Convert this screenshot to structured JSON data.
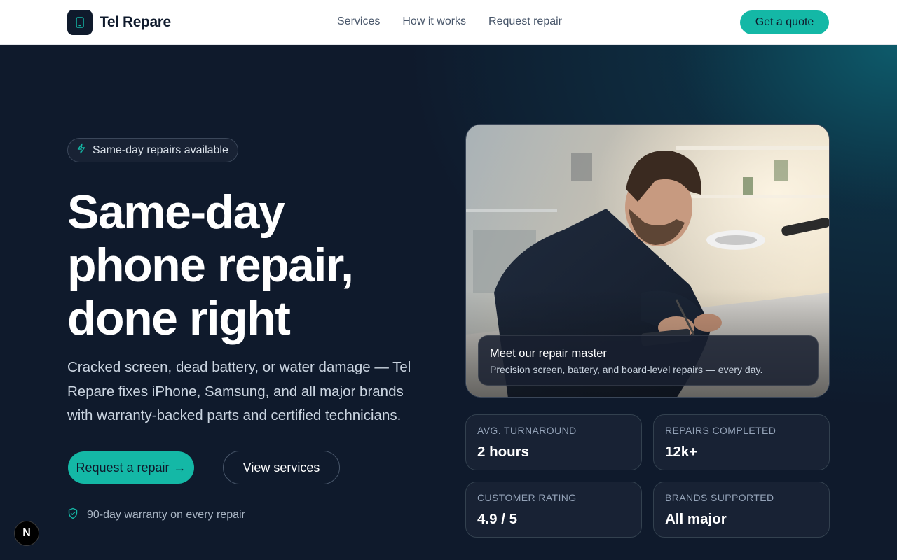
{
  "brand": {
    "name": "Tel Repare",
    "icon": "phone-icon"
  },
  "nav": {
    "items": [
      "Services",
      "How it works",
      "Request repair"
    ]
  },
  "header": {
    "cta_label": "Get a quote"
  },
  "hero": {
    "badge": "Same-day repairs available",
    "headline_lines": [
      "Same-day",
      "phone repair,",
      "done right"
    ],
    "description": "Cracked screen, dead battery, or water damage — Tel Repare fixes iPhone, Samsung, and all major brands with warranty-backed parts and certified technicians.",
    "primary_cta": "Request a repair",
    "primary_cta_icon": "→",
    "secondary_cta": "View services",
    "warranty_note": "90-day warranty on every repair"
  },
  "photo": {
    "caption_title": "Meet our repair master",
    "caption_subtitle": "Precision screen, battery, and board-level repairs — every day."
  },
  "stats": [
    {
      "label": "AVG. TURNAROUND",
      "value": "2 hours"
    },
    {
      "label": "REPAIRS COMPLETED",
      "value": "12k+"
    },
    {
      "label": "CUSTOMER RATING",
      "value": "4.9 / 5"
    },
    {
      "label": "BRANDS SUPPORTED",
      "value": "All major"
    }
  ],
  "dev_badge": {
    "label": "N"
  },
  "colors": {
    "accent": "#14b8a6",
    "dark_bg": "#0f1a2c",
    "teal_glow": "#0d5e6e"
  }
}
